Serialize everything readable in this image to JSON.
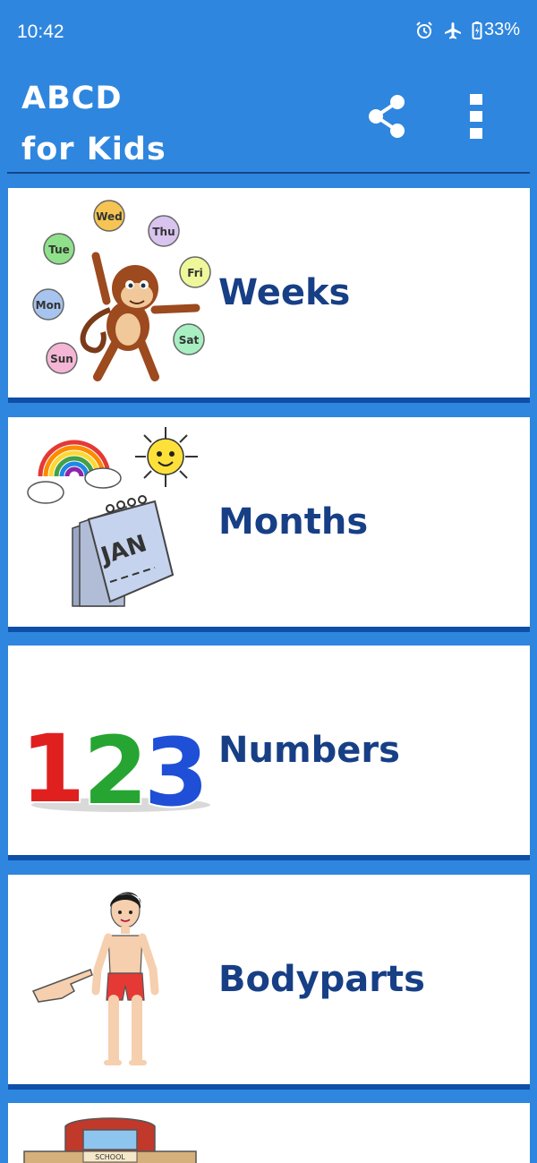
{
  "status_bar": {
    "time": "10:42",
    "battery": "33%",
    "icons": [
      "alarm-icon",
      "airplane-icon",
      "battery-icon"
    ]
  },
  "app_bar": {
    "title_line1": "ABCD",
    "title_line2": "for Kids",
    "actions": [
      "share-icon",
      "more-vert-icon"
    ]
  },
  "categories": [
    {
      "label": "Weeks",
      "art": {
        "days": [
          "Wed",
          "Thu",
          "Tue",
          "Fri",
          "Mon",
          "Sat",
          "Sun"
        ]
      }
    },
    {
      "label": "Months",
      "art": {
        "calendar_text": "JAN"
      }
    },
    {
      "label": "Numbers",
      "art": {
        "digits": [
          "1",
          "2",
          "3"
        ]
      }
    },
    {
      "label": "Bodyparts"
    },
    {
      "label": "",
      "art": {
        "sign_text": "SCHOOL"
      }
    }
  ],
  "colors": {
    "background": "#2f86de",
    "label_text": "#173f86",
    "card_border": "#0f4fa8"
  }
}
